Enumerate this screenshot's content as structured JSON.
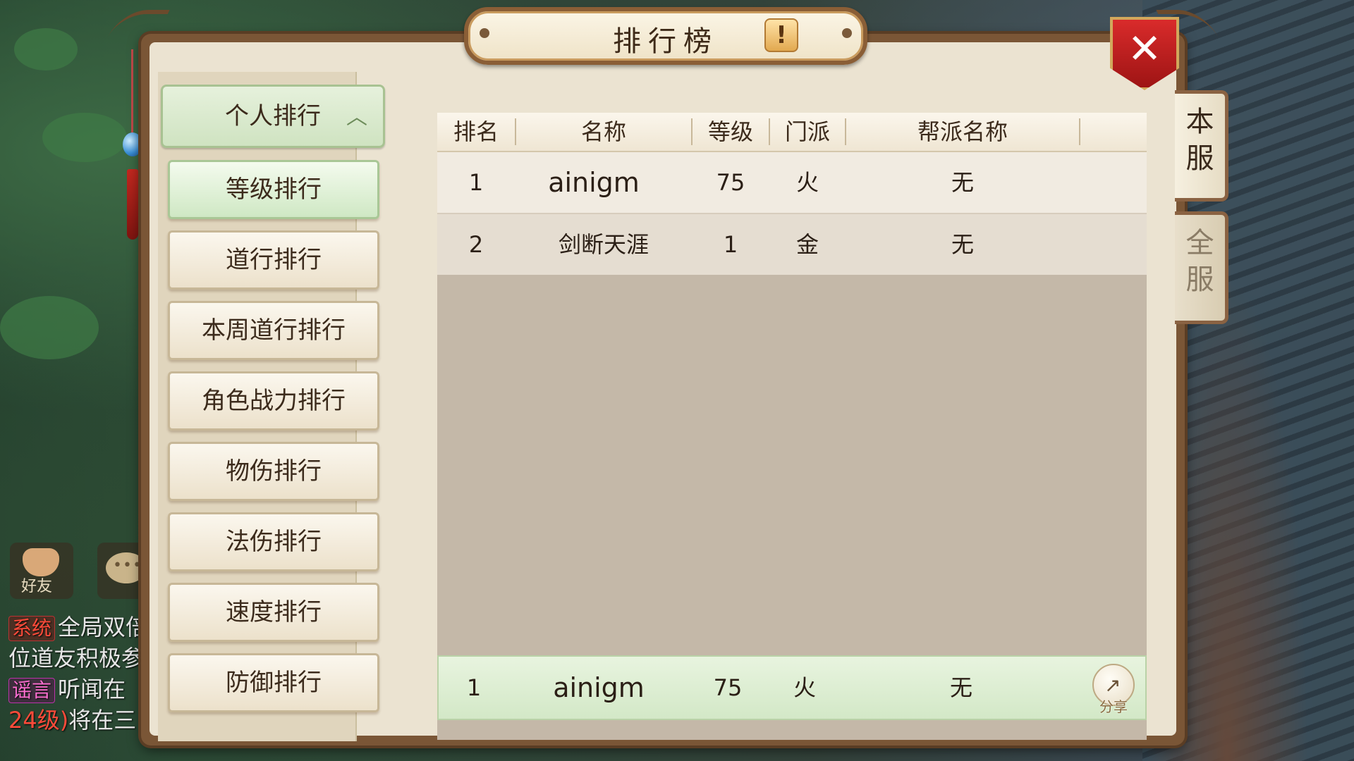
{
  "title": "排行榜",
  "info_glyph": "!",
  "close_glyph": "✕",
  "server_tabs": [
    {
      "label": "本服",
      "active": true
    },
    {
      "label": "全服",
      "active": false
    }
  ],
  "menu": {
    "header": {
      "label": "个人排行",
      "chevron": "︿"
    },
    "items": [
      {
        "label": "等级排行",
        "active": true
      },
      {
        "label": "道行排行",
        "active": false
      },
      {
        "label": "本周道行排行",
        "active": false
      },
      {
        "label": "角色战力排行",
        "active": false
      },
      {
        "label": "物伤排行",
        "active": false
      },
      {
        "label": "法伤排行",
        "active": false
      },
      {
        "label": "速度排行",
        "active": false
      },
      {
        "label": "防御排行",
        "active": false
      }
    ]
  },
  "table": {
    "columns": [
      "排名",
      "名称",
      "等级",
      "门派",
      "帮派名称"
    ],
    "rows": [
      {
        "rank": "1",
        "name": "ainigm",
        "level": "75",
        "sect": "火",
        "guild": "无"
      },
      {
        "rank": "2",
        "name": "剑断天涯",
        "level": "1",
        "sect": "金",
        "guild": "无"
      }
    ]
  },
  "my_rank": {
    "rank": "1",
    "name": "ainigm",
    "level": "75",
    "sect": "火",
    "guild": "无",
    "share_label": "分享"
  },
  "chat": {
    "friend_label": "好友",
    "lines": [
      {
        "tag": "系统",
        "text": "全局双倍"
      },
      {
        "tag": "",
        "text": "位道友积极参"
      },
      {
        "tag": "谣言",
        "text": "听闻在"
      },
      {
        "tag": "",
        "level": "24级)",
        "text": "将在三"
      }
    ]
  },
  "colors": {
    "accent_green": "#cfe8c4",
    "panel_frame": "#7a5636",
    "close_red": "#c92020"
  }
}
